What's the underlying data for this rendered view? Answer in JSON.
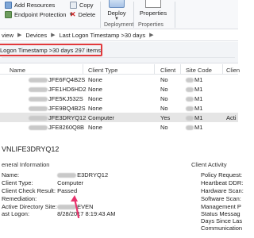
{
  "ribbon": {
    "add_resources": "Add Resources",
    "endpoint_protection": "Endpoint Protection",
    "copy": "Copy",
    "delete": "Delete",
    "deploy": "Deploy",
    "properties": "Properties",
    "deployment_group": "Deployment",
    "properties_group": "Properties"
  },
  "breadcrumb": {
    "parent_partial": "view",
    "devices": "Devices",
    "current": "Last Logon Timestamp >30 days"
  },
  "collection": {
    "title": "Logon Timestamp >30 days 297 items"
  },
  "table": {
    "columns": [
      "Name",
      "Client Type",
      "Client",
      "Site Code",
      "Clien"
    ],
    "rows": [
      {
        "name": "JFE6FQ4B2S",
        "client_type": "None",
        "client": "No",
        "site": "M1",
        "extra": ""
      },
      {
        "name": "JFE1HD6HD2",
        "client_type": "None",
        "client": "No",
        "site": "M1",
        "extra": ""
      },
      {
        "name": "JFE5KJ532S",
        "client_type": "None",
        "client": "No",
        "site": "M1",
        "extra": ""
      },
      {
        "name": "JFE9BQ4B2S",
        "client_type": "None",
        "client": "No",
        "site": "M1",
        "extra": ""
      },
      {
        "name": "JFE3DRYQ12",
        "client_type": "Computer",
        "client": "Yes",
        "site": "M1",
        "extra": "Acti"
      },
      {
        "name": "JFE8260Q8B",
        "client_type": "None",
        "client": "No",
        "site": "M1",
        "extra": ""
      }
    ]
  },
  "detail": {
    "title": "VNLIFE3DRYQ12",
    "section_general": "eneral Information",
    "section_activity": "Client Activity",
    "fields": [
      {
        "key": "Name:",
        "value": "E3DRYQ12"
      },
      {
        "key": "Client Type:",
        "value": "Computer"
      },
      {
        "key": "Client Check Result:",
        "value": "Passed"
      },
      {
        "key": "Remediation:",
        "value": ""
      },
      {
        "key": "Active Directory Site:",
        "value": "EVEN"
      },
      {
        "key": "ast Logon:",
        "value": "8/28/2017 8:19:43 AM"
      }
    ],
    "activity_items": [
      "Policy Request:",
      "Heartbeat DDR:",
      "Hardware Scan:",
      "Software Scan:",
      "Management P",
      "Status Messag",
      "Days Since Las",
      "Communication"
    ]
  },
  "colors": {
    "highlight_red": "#e2393c",
    "arrow_pink": "#e8336d",
    "selected_row": "#e5e5e5"
  },
  "icons": [
    "add-resources-icon",
    "endpoint-protection-icon",
    "copy-icon",
    "delete-icon",
    "deploy-icon",
    "properties-icon"
  ]
}
